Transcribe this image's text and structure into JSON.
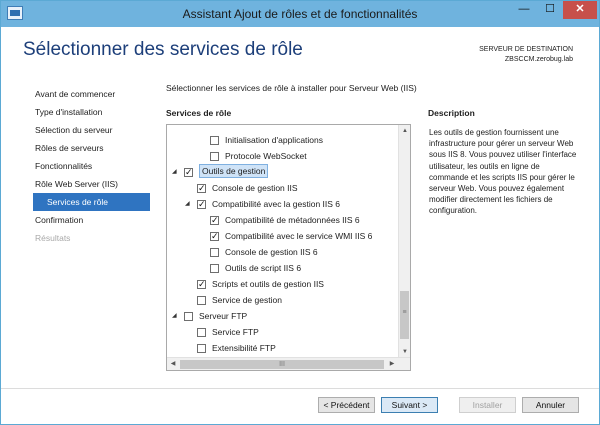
{
  "window": {
    "title": "Assistant Ajout de rôles et de fonctionnalités",
    "minimize_glyph": "—",
    "maximize_glyph": "☐",
    "close_glyph": "✕",
    "app_icon": "server-manager-icon"
  },
  "header": {
    "title": "Sélectionner des services de rôle",
    "destination_label": "SERVEUR DE DESTINATION",
    "destination_server": "ZBSCCM.zerobug.lab"
  },
  "nav": {
    "items": [
      {
        "label": "Avant de commencer",
        "state": "normal"
      },
      {
        "label": "Type d'installation",
        "state": "normal"
      },
      {
        "label": "Sélection du serveur",
        "state": "normal"
      },
      {
        "label": "Rôles de serveurs",
        "state": "normal"
      },
      {
        "label": "Fonctionnalités",
        "state": "normal"
      },
      {
        "label": "Rôle Web Server (IIS)",
        "state": "normal"
      },
      {
        "label": "Services de rôle",
        "state": "active"
      },
      {
        "label": "Confirmation",
        "state": "normal"
      },
      {
        "label": "Résultats",
        "state": "disabled"
      }
    ]
  },
  "main": {
    "instruction": "Sélectionner les services de rôle à installer pour Serveur Web (IIS)",
    "services_label": "Services de rôle",
    "tree": [
      {
        "label": "Initialisation d'applications",
        "level": 2,
        "checked": false,
        "expander": ""
      },
      {
        "label": "Protocole WebSocket",
        "level": 2,
        "checked": false,
        "expander": ""
      },
      {
        "label": "Outils de gestion",
        "level": 0,
        "checked": true,
        "expander": "◢",
        "selected": true
      },
      {
        "label": "Console de gestion IIS",
        "level": 1,
        "checked": true,
        "expander": ""
      },
      {
        "label": "Compatibilité avec la gestion IIS 6",
        "level": 1,
        "checked": true,
        "expander": "◢"
      },
      {
        "label": "Compatibilité de métadonnées IIS 6",
        "level": 2,
        "checked": true,
        "expander": ""
      },
      {
        "label": "Compatibilité avec le service WMI IIS 6",
        "level": 2,
        "checked": true,
        "expander": ""
      },
      {
        "label": "Console de gestion IIS 6",
        "level": 2,
        "checked": false,
        "expander": ""
      },
      {
        "label": "Outils de script IIS 6",
        "level": 2,
        "checked": false,
        "expander": ""
      },
      {
        "label": "Scripts et outils de gestion IIS",
        "level": 1,
        "checked": true,
        "expander": ""
      },
      {
        "label": "Service de gestion",
        "level": 1,
        "checked": false,
        "expander": ""
      },
      {
        "label": "Serveur FTP",
        "level": 0,
        "checked": false,
        "expander": "◢"
      },
      {
        "label": "Service FTP",
        "level": 1,
        "checked": false,
        "expander": ""
      },
      {
        "label": "Extensibilité FTP",
        "level": 1,
        "checked": false,
        "expander": ""
      }
    ],
    "scroll_up": "▲",
    "scroll_down": "▼",
    "scroll_left": "◀",
    "scroll_right": "▶",
    "v_thumb_grip": "≡",
    "h_thumb_grip": "III"
  },
  "description": {
    "label": "Description",
    "text": "Les outils de gestion fournissent une infrastructure pour gérer un serveur Web sous IIS 8. Vous pouvez utiliser l'interface utilisateur, les outils en ligne de commande et les scripts IIS pour gérer le serveur Web. Vous pouvez également modifier directement les fichiers de configuration."
  },
  "footer": {
    "previous": "< Précédent",
    "next": "Suivant >",
    "install": "Installer",
    "cancel": "Annuler"
  }
}
